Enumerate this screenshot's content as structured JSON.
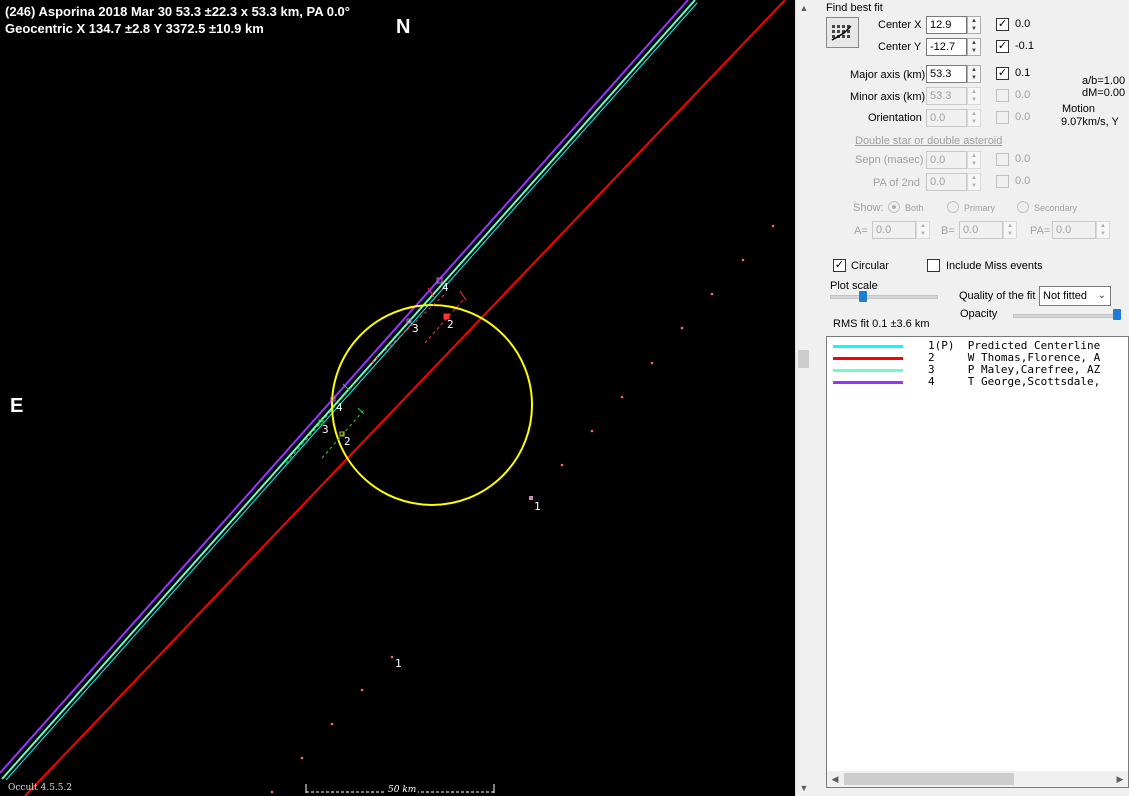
{
  "plot": {
    "title_line1": "(246) Asporina  2018 Mar 30  53.3 ±22.3 x 53.3 km, PA 0.0°",
    "title_line2": "Geocentric  X  134.7 ±2.8  Y 3372.5 ±10.9 km",
    "north_label": "N",
    "east_label": "E",
    "scale_label": "50 km",
    "version": "Occult 4.5.5.2",
    "chord_labels": {
      "top_4": "4",
      "top_3": "3",
      "top_2": "2",
      "bottom_4": "4",
      "bottom_3": "3",
      "bottom_2": "2",
      "pred_upper_1": "1",
      "pred_lower_1": "1"
    },
    "colors": {
      "ellipse": "#ffff00",
      "chord_1": "#00ffff",
      "chord_2": "#ff0000",
      "chord_3": "#66ffcc",
      "chord_4": "#9933ff",
      "reappear": "#ff3333",
      "disappear": "#33cc33"
    }
  },
  "panel": {
    "find_best_fit": "Find best fit",
    "fit_icon": "fit-grid-icon",
    "center_x": {
      "label": "Center X",
      "value": "12.9",
      "checked": true,
      "check_value": "0.0"
    },
    "center_y": {
      "label": "Center Y",
      "value": "-12.7",
      "checked": true,
      "check_value": "-0.1"
    },
    "major_axis": {
      "label": "Major axis (km)",
      "value": "53.3",
      "checked": true,
      "check_value": "0.1"
    },
    "minor_axis": {
      "label": "Minor axis (km)",
      "value": "53.3",
      "checked": false,
      "check_value": "0.0"
    },
    "orientation": {
      "label": "Orientation",
      "value": "0.0",
      "checked": false,
      "check_value": "0.0"
    },
    "ab_ratio": "a/b=1.00",
    "dm": "dM=0.00",
    "motion_label": "Motion",
    "motion_value": "9.07km/s, Y",
    "double_star_link": "Double star  or  double asteroid",
    "sepn": {
      "label": "Sepn (masec)",
      "value": "0.0",
      "check_value": "0.0"
    },
    "pa2nd": {
      "label": "PA of 2nd",
      "value": "0.0",
      "check_value": "0.0"
    },
    "show_label": "Show:",
    "show_options": [
      "Both",
      "Primary",
      "Secondary"
    ],
    "a_label": "A=",
    "a_value": "0.0",
    "b_label": "B=",
    "b_value": "0.0",
    "pa_label": "PA=",
    "pa_value": "0.0",
    "circular_label": "Circular",
    "circular_checked": true,
    "include_miss_label": "Include Miss events",
    "include_miss_checked": false,
    "plot_scale_label": "Plot scale",
    "quality_label": "Quality of the fit",
    "quality_value": "Not fitted",
    "opacity_label": "Opacity",
    "rms_fit": "RMS fit 0.1 ±3.6 km",
    "legend": [
      {
        "color": "#00ffff",
        "text": "1(P)  Predicted Centerline"
      },
      {
        "color": "#ff0000",
        "text": "2     W Thomas,Florence, A"
      },
      {
        "color": "#66ffcc",
        "text": "3     P Maley,Carefree, AZ"
      },
      {
        "color": "#9933ff",
        "text": "4     T George,Scottsdale,"
      }
    ]
  }
}
